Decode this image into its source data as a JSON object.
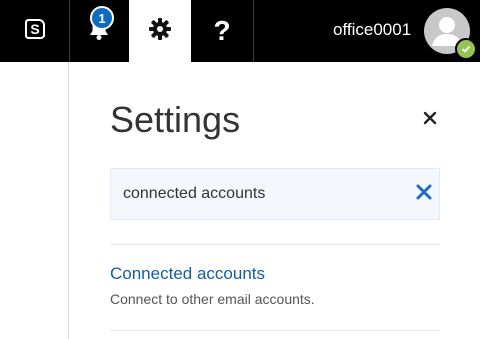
{
  "header": {
    "notification_count": "1",
    "help_label": "?",
    "user_name": "office0001",
    "icons": [
      "skype-icon",
      "bell-icon",
      "gear-icon",
      "help-icon",
      "avatar",
      "presence-available-icon"
    ],
    "colors": {
      "bar": "#000000",
      "badge": "#0f6cbd",
      "presence": "#92c353"
    }
  },
  "settings": {
    "title": "Settings",
    "search": {
      "value": "connected accounts"
    },
    "results": [
      {
        "title": "Connected accounts",
        "description": "Connect to other email accounts."
      }
    ],
    "link_color": "#0f5fa8"
  }
}
